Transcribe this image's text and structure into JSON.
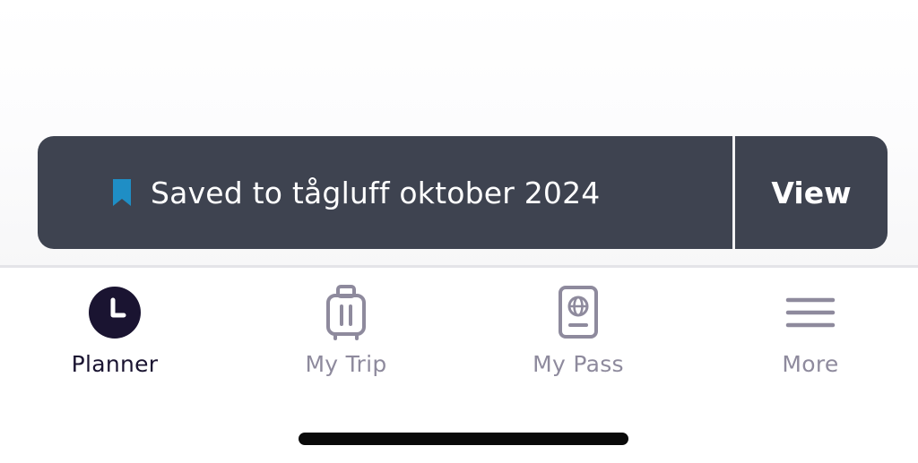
{
  "toast": {
    "icon": "bookmark-icon",
    "message": "Saved to tågluff oktober 2024",
    "action_label": "View",
    "accent_color": "#1f8ec5",
    "background_color": "#3e4350"
  },
  "tabbar": {
    "active_index": 0,
    "active_color": "#1a1431",
    "inactive_color": "#8e8a9d",
    "tabs": [
      {
        "label": "Planner",
        "icon": "clock-icon",
        "active": true
      },
      {
        "label": "My Trip",
        "icon": "suitcase-icon",
        "active": false
      },
      {
        "label": "My Pass",
        "icon": "passport-icon",
        "active": false
      },
      {
        "label": "More",
        "icon": "menu-icon",
        "active": false
      }
    ]
  }
}
